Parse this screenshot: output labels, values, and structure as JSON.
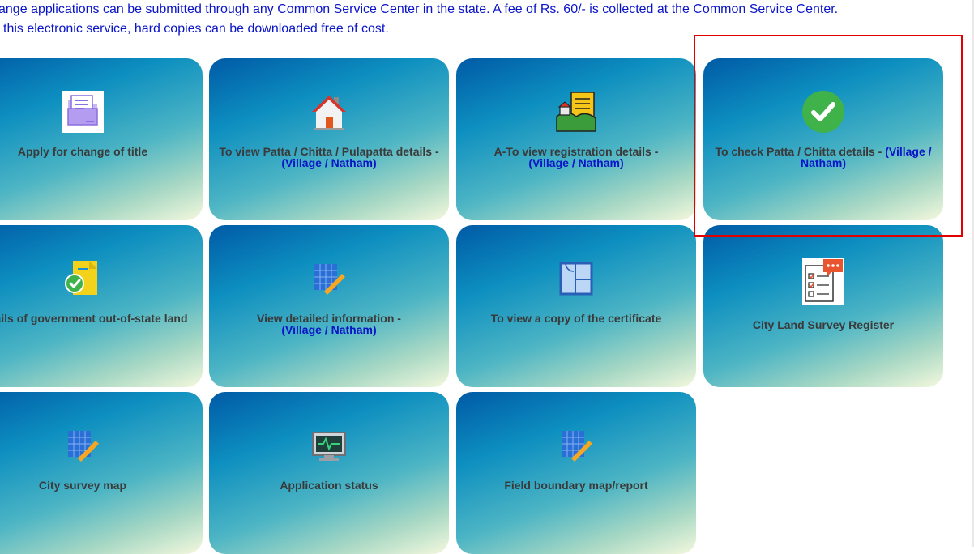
{
  "intro": {
    "line1": "ange applications can be submitted through any Common Service Center in the state. A fee of Rs. 60/- is collected at the Common Service Center.",
    "line2": "this electronic service, hard copies can be downloaded free of cost."
  },
  "cards": [
    {
      "title": "Apply for change of title",
      "suffix": "",
      "icon": "folder-document-icon"
    },
    {
      "title": "To view Patta / Chitta / Pulapatta details -",
      "suffix": "(Village / Natham)",
      "icon": "house-icon"
    },
    {
      "title": "A-To view registration details -",
      "suffix": "(Village / Natham)",
      "icon": "town-document-icon"
    },
    {
      "title": "To check Patta / Chitta details -",
      "suffix": "(Village / Natham)",
      "icon": "green-check-icon"
    },
    {
      "title": "details of government out-of-state land",
      "suffix": "",
      "icon": "document-check-icon"
    },
    {
      "title": "View detailed information -",
      "suffix": "(Village / Natham)",
      "icon": "grid-ruler-icon"
    },
    {
      "title": "To view a copy of the certificate",
      "suffix": "",
      "icon": "floor-plan-icon"
    },
    {
      "title": "City Land Survey Register",
      "suffix": "",
      "icon": "checklist-chat-icon"
    },
    {
      "title": "City survey map",
      "suffix": "",
      "icon": "grid-ruler-icon"
    },
    {
      "title": "Application status",
      "suffix": "",
      "icon": "monitor-pulse-icon"
    },
    {
      "title": "Field boundary map/report",
      "suffix": "",
      "icon": "grid-ruler-icon"
    }
  ],
  "colors": {
    "intro_text": "#0a14c8",
    "link_text": "#0a14c8",
    "card_text": "#3a3a3a",
    "highlight_border": "#e00000"
  }
}
